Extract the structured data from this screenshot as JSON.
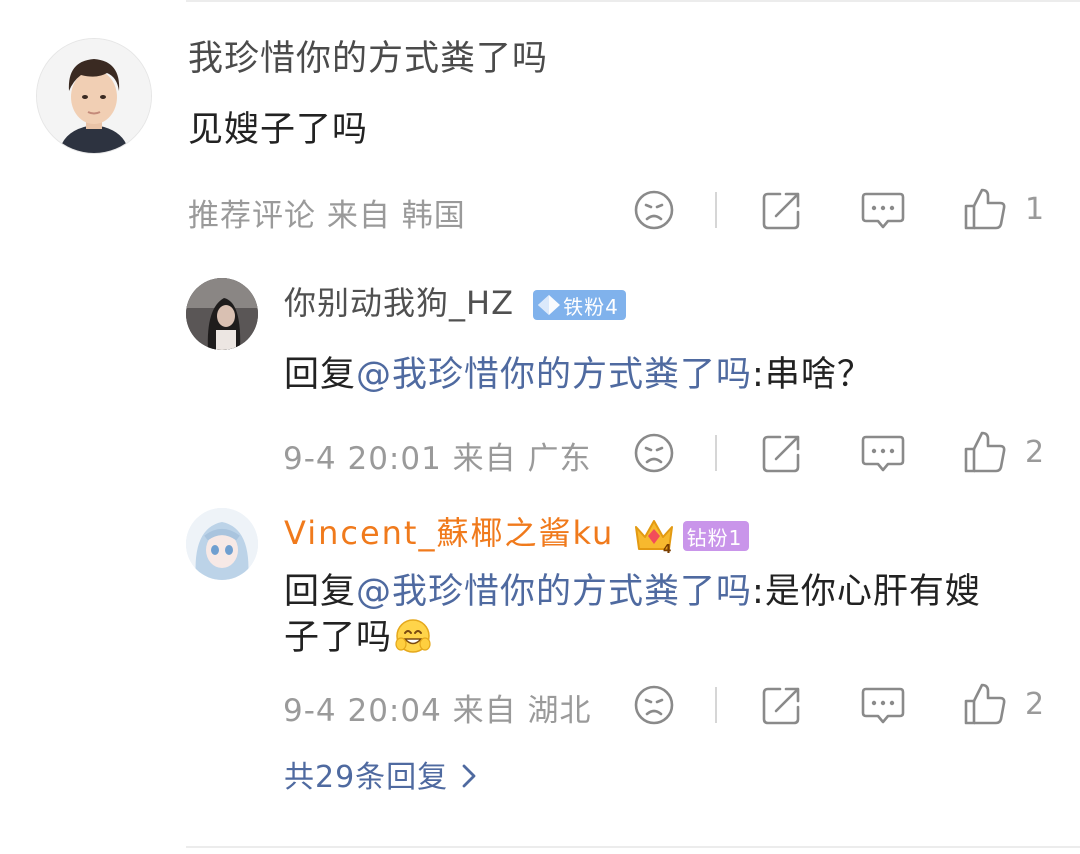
{
  "main_comment": {
    "author": "我珍惜你的方式粪了吗",
    "text": "见嫂子了吗",
    "meta": "推荐评论  来自 韩国",
    "like_count": "1"
  },
  "replies": [
    {
      "author": "你别动我狗_HZ",
      "badge": "铁粉4",
      "reply_prefix": "回复",
      "mention": "@我珍惜你的方式粪了吗",
      "text": ":串啥？",
      "meta": "9-4 20:01  来自 广东",
      "like_count": "2"
    },
    {
      "author": "Vincent_蘇椰之酱ku",
      "badge": "钻粉1",
      "crown_level": "4",
      "reply_prefix": "回复",
      "mention": "@我珍惜你的方式粪了吗",
      "text_line1": ":是你心肝有嫂",
      "text_line2": "子了吗",
      "meta": "9-4 20:04  来自 湖北",
      "like_count": "2"
    }
  ],
  "more_replies": "共29条回复 ",
  "colors": {
    "mention": "#4f6aa0",
    "orange_name": "#f07a1c",
    "meta_gray": "#9a9a9a",
    "badge_blue": "#80b2ec",
    "badge_purple": "#c995ea"
  },
  "icons": [
    "sad-face-icon",
    "share-icon",
    "comment-icon",
    "thumbs-up-icon",
    "chevron-right-icon",
    "diamond-icon",
    "crown-icon",
    "smile-emoji-icon"
  ]
}
